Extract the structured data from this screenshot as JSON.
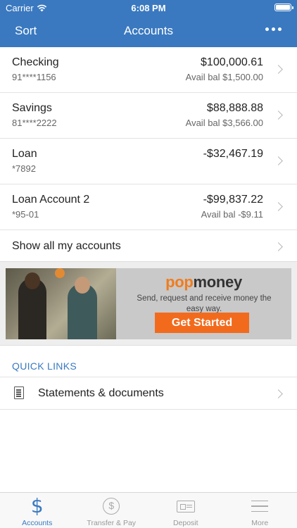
{
  "status_bar": {
    "carrier": "Carrier",
    "time": "6:08 PM"
  },
  "nav": {
    "sort_label": "Sort",
    "title": "Accounts",
    "more_icon": "more-horizontal-icon"
  },
  "accounts": [
    {
      "name": "Checking",
      "number": "91****1156",
      "balance": "$100,000.61",
      "available": "Avail bal $1,500.00"
    },
    {
      "name": "Savings",
      "number": "81****2222",
      "balance": "$88,888.88",
      "available": "Avail bal $3,566.00"
    },
    {
      "name": "Loan",
      "number": "*7892",
      "balance": "-$32,467.19",
      "available": ""
    },
    {
      "name": "Loan Account 2",
      "number": "*95-01",
      "balance": "-$99,837.22",
      "available": "Avail bal -$9.11"
    }
  ],
  "show_all_label": "Show all my accounts",
  "promo": {
    "brand_pop": "pop",
    "brand_money": "money",
    "tagline": "Send, request and receive money the easy way.",
    "cta_label": "Get Started",
    "colors": {
      "brand_orange": "#f26b1d"
    }
  },
  "quick_links": {
    "header": "QUICK LINKS",
    "items": [
      {
        "label": "Statements & documents",
        "icon": "document-icon"
      }
    ]
  },
  "tabbar": {
    "tabs": [
      {
        "label": "Accounts",
        "icon": "dollar-icon",
        "active": true
      },
      {
        "label": "Transfer & Pay",
        "icon": "transfer-icon",
        "active": false
      },
      {
        "label": "Deposit",
        "icon": "check-deposit-icon",
        "active": false
      },
      {
        "label": "More",
        "icon": "menu-icon",
        "active": false
      }
    ]
  },
  "colors": {
    "primary": "#3a79c0",
    "background": "#ffffff",
    "divider": "#e3e3e3"
  }
}
